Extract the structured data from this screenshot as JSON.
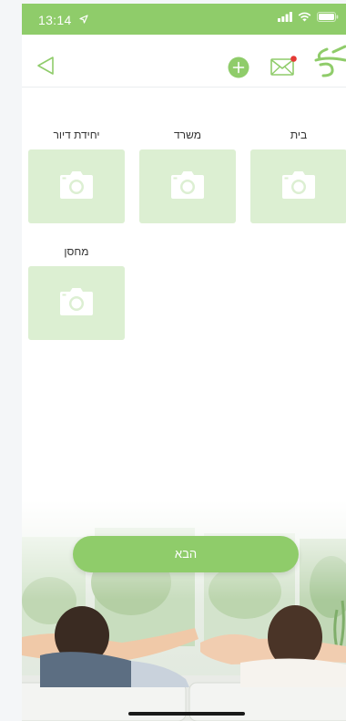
{
  "status_bar": {
    "time": "13:14",
    "location_icon": "location-arrow-icon",
    "signal_icon": "signal-icon",
    "wifi_icon": "wifi-icon",
    "battery_icon": "battery-icon"
  },
  "nav": {
    "back_icon": "back-arrow-icon",
    "add_icon": "add-circle-icon",
    "mail_icon": "mail-icon",
    "mail_has_notification": true,
    "logo_icon": "brand-logo-icon"
  },
  "tiles": [
    {
      "label": "בית",
      "icon": "camera-icon"
    },
    {
      "label": "משרד",
      "icon": "camera-icon"
    },
    {
      "label": "יחידת דיור",
      "icon": "camera-icon"
    },
    {
      "label": "מחסן",
      "icon": "camera-icon"
    }
  ],
  "footer": {
    "next_label": "הבא"
  },
  "colors": {
    "accent": "#8fcc6a",
    "tile_bg": "#dcefd2",
    "notification_dot": "#e53935"
  }
}
